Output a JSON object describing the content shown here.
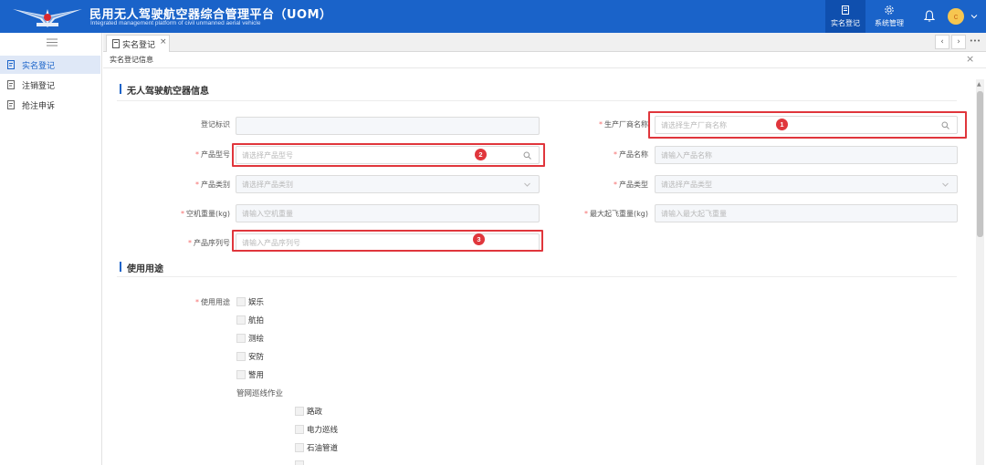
{
  "header": {
    "title": "民用无人驾驶航空器综合管理平台（UOM）",
    "subtitle": "Integrated management platform of civil unmanned aerial vehicle",
    "nav": [
      {
        "label": "实名登记",
        "icon": "document-icon",
        "active": true
      },
      {
        "label": "系统管理",
        "icon": "settings-icon",
        "active": false
      }
    ],
    "avatar": "c"
  },
  "sidebar": {
    "items": [
      {
        "label": "实名登记",
        "active": true
      },
      {
        "label": "注销登记",
        "active": false
      },
      {
        "label": "抢注申诉",
        "active": false
      }
    ]
  },
  "tabs": [
    {
      "label": "实名登记",
      "close": "×"
    }
  ],
  "tab_controls": {
    "prev": "‹",
    "next": "›",
    "more": "•••"
  },
  "breadcrumb": "实名登记信息",
  "close_symbol": "×",
  "sections": {
    "uav_info": "无人驾驶航空器信息",
    "usage": "使用用途"
  },
  "form": {
    "registration_id": {
      "label": "登记标识",
      "placeholder": ""
    },
    "manufacturer": {
      "label": "生产厂商名称",
      "placeholder": "请选择生产厂商名称",
      "required": "*"
    },
    "product_model": {
      "label": "产品型号",
      "placeholder": "请选择产品型号",
      "required": "*"
    },
    "product_name": {
      "label": "产品名称",
      "placeholder": "请输入产品名称",
      "required": "*"
    },
    "product_category": {
      "label": "产品类别",
      "placeholder": "请选择产品类别",
      "required": "*"
    },
    "product_type": {
      "label": "产品类型",
      "placeholder": "请选择产品类型",
      "required": "*"
    },
    "empty_weight": {
      "label": "空机重量(kg)",
      "placeholder": "请输入空机重量",
      "required": "*"
    },
    "max_takeoff_weight": {
      "label": "最大起飞重量(kg)",
      "placeholder": "请输入最大起飞重量",
      "required": "*"
    },
    "serial_number": {
      "label": "产品序列号",
      "placeholder": "请输入产品序列号",
      "required": "*"
    }
  },
  "usage": {
    "label": "使用用途",
    "required": "*",
    "options": [
      "娱乐",
      "航拍",
      "测绘",
      "安防",
      "警用"
    ],
    "group_label": "管网巡线作业",
    "group_options": [
      "路政",
      "电力巡线",
      "石油管道"
    ]
  },
  "annotations": [
    "1",
    "2",
    "3"
  ],
  "colors": {
    "header": "#1a63c9",
    "highlight": "#e0363c",
    "required": "#f56c6c"
  }
}
